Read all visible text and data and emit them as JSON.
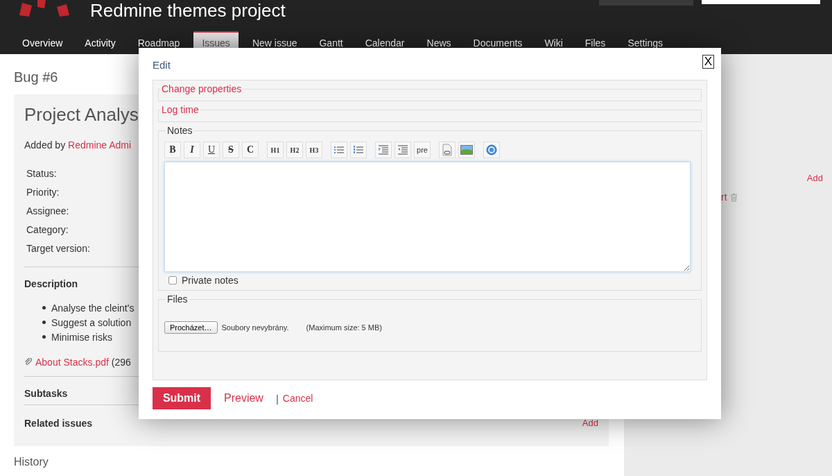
{
  "header": {
    "title": "Redmine themes project"
  },
  "tabs": [
    {
      "label": "Overview",
      "selected": false
    },
    {
      "label": "Activity",
      "selected": false
    },
    {
      "label": "Roadmap",
      "selected": false
    },
    {
      "label": "Issues",
      "selected": true
    },
    {
      "label": "New issue",
      "selected": false
    },
    {
      "label": "Gantt",
      "selected": false
    },
    {
      "label": "Calendar",
      "selected": false
    },
    {
      "label": "News",
      "selected": false
    },
    {
      "label": "Documents",
      "selected": false
    },
    {
      "label": "Wiki",
      "selected": false
    },
    {
      "label": "Files",
      "selected": false
    },
    {
      "label": "Settings",
      "selected": false
    }
  ],
  "issue": {
    "heading": "Bug #6",
    "subject": "Project Analys",
    "author_prefix": "Added by",
    "author": "Redmine Admi",
    "attributes": [
      "Status:",
      "Priority:",
      "Assignee:",
      "Category:",
      "Target version:"
    ],
    "description_title": "Description",
    "description_items": [
      "Analyse the cleint's",
      "Suggest a solution",
      "Minimise risks"
    ],
    "attachment": {
      "name": "About Stacks.pdf",
      "size": "(296"
    },
    "subtasks": "Subtasks",
    "related": {
      "title": "Related issues",
      "action": "Add"
    }
  },
  "history": "History",
  "sidebar": {
    "add": "Add",
    "watcher": "rt"
  },
  "dialog": {
    "title": "Edit",
    "close": "X",
    "sections": [
      "Change properties",
      "Log time"
    ],
    "notes": {
      "legend": "Notes",
      "toolbar": [
        "B",
        "I",
        "U",
        "S",
        "C",
        "H1",
        "H2",
        "H3",
        "pre"
      ],
      "private": {
        "label": "Private notes",
        "checked": false
      }
    },
    "files": {
      "legend": "Files",
      "browse": "Procházet…",
      "status": "Soubory nevybrány.",
      "max": "(Maximum size: 5 MB)"
    },
    "submit": "Submit",
    "preview": "Preview",
    "separator": "|",
    "cancel": "Cancel"
  }
}
